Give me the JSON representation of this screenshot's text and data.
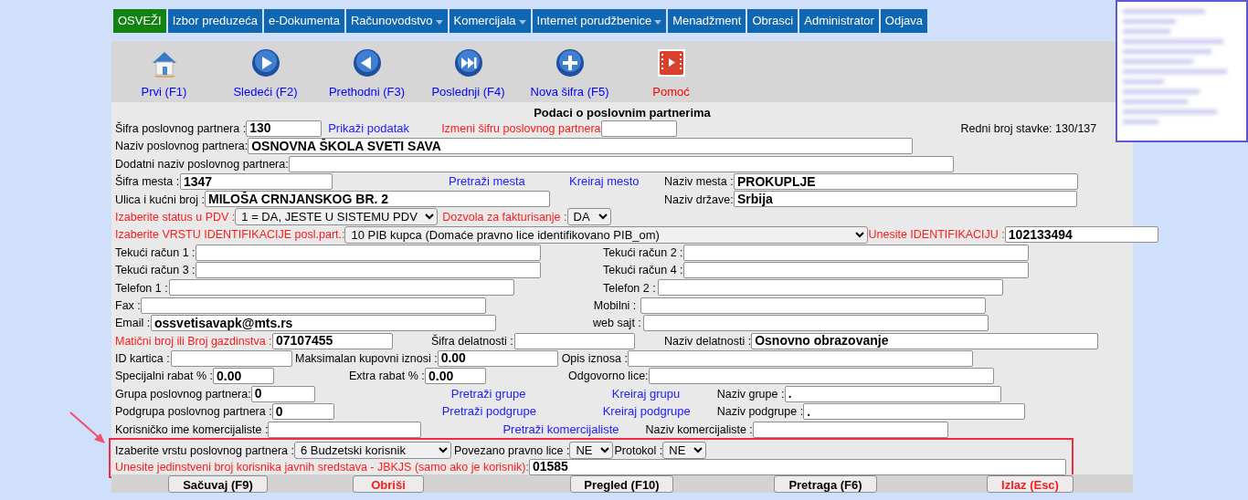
{
  "menu": [
    {
      "label": "OSVEŽI",
      "kind": "action",
      "has_dropdown": false
    },
    {
      "label": "Izbor preduzeća",
      "kind": "menu",
      "has_dropdown": false
    },
    {
      "label": "e-Dokumenta",
      "kind": "menu",
      "has_dropdown": false
    },
    {
      "label": "Računovodstvo",
      "kind": "menu",
      "has_dropdown": true
    },
    {
      "label": "Komercijala",
      "kind": "menu",
      "has_dropdown": true
    },
    {
      "label": "Internet porudžbenice",
      "kind": "menu",
      "has_dropdown": true
    },
    {
      "label": "Menadžment",
      "kind": "menu",
      "has_dropdown": false
    },
    {
      "label": "Obrasci",
      "kind": "menu",
      "has_dropdown": false
    },
    {
      "label": "Administrator",
      "kind": "menu",
      "has_dropdown": false
    },
    {
      "label": "Odjava",
      "kind": "menu",
      "has_dropdown": false
    }
  ],
  "toolbar": [
    {
      "kind": "home",
      "label": "Prvi (F1)",
      "color": "#0000ff"
    },
    {
      "kind": "next",
      "label": "Sledeći (F2)",
      "color": "#0000ff"
    },
    {
      "kind": "previous",
      "label": "Prethodni (F3)",
      "color": "#0000ff"
    },
    {
      "kind": "last",
      "label": "Poslednji (F4)",
      "color": "#0000ff"
    },
    {
      "kind": "add",
      "label": "Nova šifra (F5)",
      "color": "#0000ff"
    },
    {
      "kind": "video",
      "label": "Pomoć",
      "color": "#ff0000"
    }
  ],
  "form": {
    "title": "Podaci o poslovnim partnerima",
    "rows": [
      [
        {
          "kind": "label",
          "text": "Šifra poslovnog partnera :"
        },
        {
          "kind": "field",
          "value": "130"
        },
        {
          "kind": "link",
          "text": "Prikaži podatak"
        },
        {
          "kind": "alert_label",
          "text": "Izmeni šifru poslovnog partnera"
        },
        {
          "kind": "field"
        },
        {
          "kind": "info",
          "text": "Redni broj stavke: 130/137"
        }
      ],
      [
        {
          "kind": "label",
          "text": "Naziv poslovnog partnera:"
        },
        {
          "kind": "field",
          "value": "OSNOVNA ŠKOLA SVETI SAVA"
        }
      ],
      [
        {
          "kind": "label",
          "text": "Dodatni naziv poslovnog partnera:"
        },
        {
          "kind": "field"
        }
      ],
      [
        {
          "kind": "label",
          "text": "Šifra mesta :"
        },
        {
          "kind": "field",
          "value": "1347"
        },
        {
          "kind": "link",
          "text": "Pretraži mesta"
        },
        {
          "kind": "link",
          "text": "Kreiraj mesto"
        },
        {
          "kind": "label",
          "text": "Naziv mesta :"
        },
        {
          "kind": "field",
          "value": "PROKUPLJE"
        }
      ],
      [
        {
          "kind": "label",
          "text": "Ulica i kućni broj :"
        },
        {
          "kind": "field",
          "value": "MILOŠA CRNJANSKOG BR. 2"
        },
        {
          "kind": "label",
          "text": "Naziv države:"
        },
        {
          "kind": "field",
          "value": "Srbija"
        }
      ],
      [
        {
          "kind": "alert_label",
          "text": "Izaberite status u PDV :"
        },
        {
          "kind": "select",
          "value": "1 = DA, JESTE U SISTEMU PDV"
        },
        {
          "kind": "alert_label",
          "text": "Dozvola za fakturisanje :"
        },
        {
          "kind": "select",
          "value": "DA"
        }
      ],
      [
        {
          "kind": "alert_label",
          "text": "Izaberite VRSTU IDENTIFIKACIJE posl.part.:"
        },
        {
          "kind": "select",
          "value": "10 PIB kupca (Domaće pravno lice identifikovano PIB_om)"
        },
        {
          "kind": "alert_label",
          "text": "Unesite IDENTIFIKACIJU :"
        },
        {
          "kind": "field",
          "value": "102133494"
        }
      ],
      [
        {
          "kind": "label",
          "text": "Tekući račun 1 :"
        },
        {
          "kind": "field"
        },
        {
          "kind": "label",
          "text": "Tekući račun 2 :"
        },
        {
          "kind": "field"
        }
      ],
      [
        {
          "kind": "label",
          "text": "Tekući račun 3 :"
        },
        {
          "kind": "field"
        },
        {
          "kind": "label",
          "text": "Tekući račun 4 :"
        },
        {
          "kind": "field"
        }
      ],
      [
        {
          "kind": "label",
          "text": "Telefon 1 :"
        },
        {
          "kind": "field"
        },
        {
          "kind": "label",
          "text": "Telefon 2 :"
        },
        {
          "kind": "field"
        }
      ],
      [
        {
          "kind": "label",
          "text": "Fax :"
        },
        {
          "kind": "field"
        },
        {
          "kind": "label",
          "text": "Mobilni :"
        },
        {
          "kind": "field"
        }
      ],
      [
        {
          "kind": "label",
          "text": "Email :"
        },
        {
          "kind": "field",
          "value": "ossvetisavapk@mts.rs"
        },
        {
          "kind": "label",
          "text": "web sajt :"
        },
        {
          "kind": "field"
        }
      ],
      [
        {
          "kind": "alert_label",
          "text": "Matični broj ili Broj gazdinstva :"
        },
        {
          "kind": "field",
          "value": "07107455"
        },
        {
          "kind": "label",
          "text": "Šifra delatnosti :"
        },
        {
          "kind": "field"
        },
        {
          "kind": "label",
          "text": "Naziv delatnosti :"
        },
        {
          "kind": "field",
          "value": "Osnovno obrazovanje"
        }
      ],
      [
        {
          "kind": "label",
          "text": "ID kartica :"
        },
        {
          "kind": "field"
        },
        {
          "kind": "label",
          "text": "Maksimalan kupovni iznosi :"
        },
        {
          "kind": "field",
          "value": "0.00"
        },
        {
          "kind": "label",
          "text": "Opis iznosa :"
        },
        {
          "kind": "field"
        }
      ],
      [
        {
          "kind": "label",
          "text": "Specijalni rabat % :"
        },
        {
          "kind": "field",
          "value": "0.00"
        },
        {
          "kind": "label",
          "text": "Extra rabat % :"
        },
        {
          "kind": "field",
          "value": "0.00"
        },
        {
          "kind": "label",
          "text": "Odgovorno lice:"
        },
        {
          "kind": "field"
        }
      ],
      [
        {
          "kind": "label",
          "text": "Grupa poslovnog partnera:"
        },
        {
          "kind": "field",
          "value": "0"
        },
        {
          "kind": "link",
          "text": "Pretraži grupe"
        },
        {
          "kind": "link",
          "text": "Kreiraj grupu"
        },
        {
          "kind": "label",
          "text": "Naziv grupe :"
        },
        {
          "kind": "field",
          "value": "."
        }
      ],
      [
        {
          "kind": "label",
          "text": "Podgrupa poslovnog partnera :"
        },
        {
          "kind": "field",
          "value": "0"
        },
        {
          "kind": "link",
          "text": "Pretraži podgrupe"
        },
        {
          "kind": "link",
          "text": "Kreiraj podgrupe"
        },
        {
          "kind": "label",
          "text": "Naziv podgrupe :"
        },
        {
          "kind": "field",
          "value": "."
        }
      ],
      [
        {
          "kind": "label",
          "text": "Korisničko ime komercijaliste :"
        },
        {
          "kind": "field"
        },
        {
          "kind": "link",
          "text": "Pretraži komercijaliste"
        },
        {
          "kind": "label",
          "text": "Naziv komercijaliste :"
        },
        {
          "kind": "field"
        }
      ]
    ],
    "highlighted_rows": [
      [
        {
          "kind": "label",
          "text": "Izaberite vrstu poslovnog partnera :"
        },
        {
          "kind": "select",
          "value": "6 Budzetski korisnik"
        },
        {
          "kind": "label",
          "text": "Povezano pravno lice :"
        },
        {
          "kind": "select",
          "value": "NE"
        },
        {
          "kind": "label",
          "text": "Protokol :"
        },
        {
          "kind": "select",
          "value": "NE"
        }
      ],
      [
        {
          "kind": "alert_label",
          "text": "Unesite jedinstveni broj korisnika javnih sredstava - JBKJS (samo ako je korisnik):"
        },
        {
          "kind": "field",
          "value": "01585"
        }
      ]
    ]
  },
  "buttons": [
    {
      "label": "Sačuvaj (F9)",
      "alert": false
    },
    {
      "label": "Obriši",
      "alert": true
    },
    {
      "label": "Pregled (F10)",
      "alert": false
    },
    {
      "label": "Pretraga (F6)",
      "alert": false
    },
    {
      "label": "Izlaz (Esc)",
      "alert": true
    }
  ]
}
